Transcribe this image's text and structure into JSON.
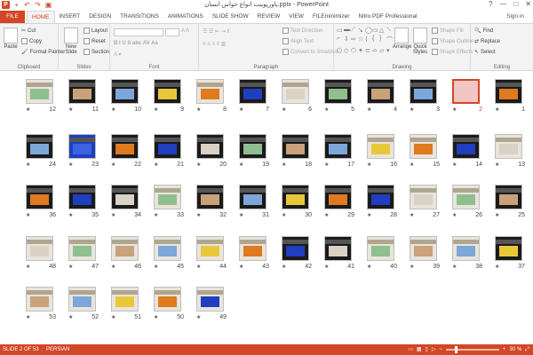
{
  "app": {
    "title": "پاورپوینت انواع حواس انسان.pptx - PowerPoint",
    "window_controls": [
      "?",
      "—",
      "□",
      "✕"
    ],
    "sign_in": "Sign in"
  },
  "tabs": {
    "file": "FILE",
    "items": [
      "HOME",
      "INSERT",
      "DESIGN",
      "TRANSITIONS",
      "ANIMATIONS",
      "SLIDE SHOW",
      "REVIEW",
      "VIEW",
      "FILEminimizer",
      "Nitro PDF Professional"
    ],
    "active": "HOME"
  },
  "ribbon": {
    "clipboard": {
      "label": "Clipboard",
      "paste": "Paste",
      "cut": "Cut",
      "copy": "Copy",
      "format_painter": "Format Painter"
    },
    "slides": {
      "label": "Slides",
      "new_slide": "New Slide",
      "layout": "Layout",
      "reset": "Reset",
      "section": "Section"
    },
    "font": {
      "label": "Font"
    },
    "paragraph": {
      "label": "Paragraph",
      "text_direction": "Text Direction",
      "align_text": "Align Text",
      "convert_smartart": "Convert to SmartArt"
    },
    "drawing": {
      "label": "Drawing",
      "arrange": "Arrange",
      "quick_styles": "Quick Styles",
      "shape_fill": "Shape Fill",
      "shape_outline": "Shape Outline",
      "shape_effects": "Shape Effects"
    },
    "editing": {
      "label": "Editing",
      "find": "Find",
      "replace": "Replace",
      "select": "Select"
    }
  },
  "slides": {
    "count": 53,
    "selected": 2,
    "numbers": [
      [
        12,
        11,
        10,
        9,
        8,
        7,
        6,
        5,
        4,
        3,
        2,
        1
      ],
      [
        24,
        23,
        22,
        21,
        20,
        19,
        18,
        17,
        16,
        15,
        14,
        13
      ],
      [
        36,
        35,
        34,
        33,
        32,
        31,
        30,
        29,
        28,
        27,
        26,
        25
      ],
      [
        48,
        47,
        46,
        45,
        44,
        43,
        42,
        41,
        40,
        39,
        38,
        37
      ],
      [
        53,
        52,
        51,
        50,
        49
      ]
    ],
    "light_slides": [
      6,
      8,
      12,
      13,
      15,
      16,
      26,
      27,
      33,
      38,
      39,
      40,
      43,
      44,
      45,
      46,
      47,
      48,
      49,
      50,
      51,
      52,
      53
    ],
    "accent_colors": {
      "blue": "#1f3fbf",
      "orange": "#e07a1e",
      "yellow": "#e8c83a",
      "pink": "#f3c6c6"
    }
  },
  "status": {
    "slide_info": "SLIDE 2 OF 53",
    "language": "PERSIAN",
    "zoom": "30 %"
  },
  "colors": {
    "accent": "#d24726"
  }
}
